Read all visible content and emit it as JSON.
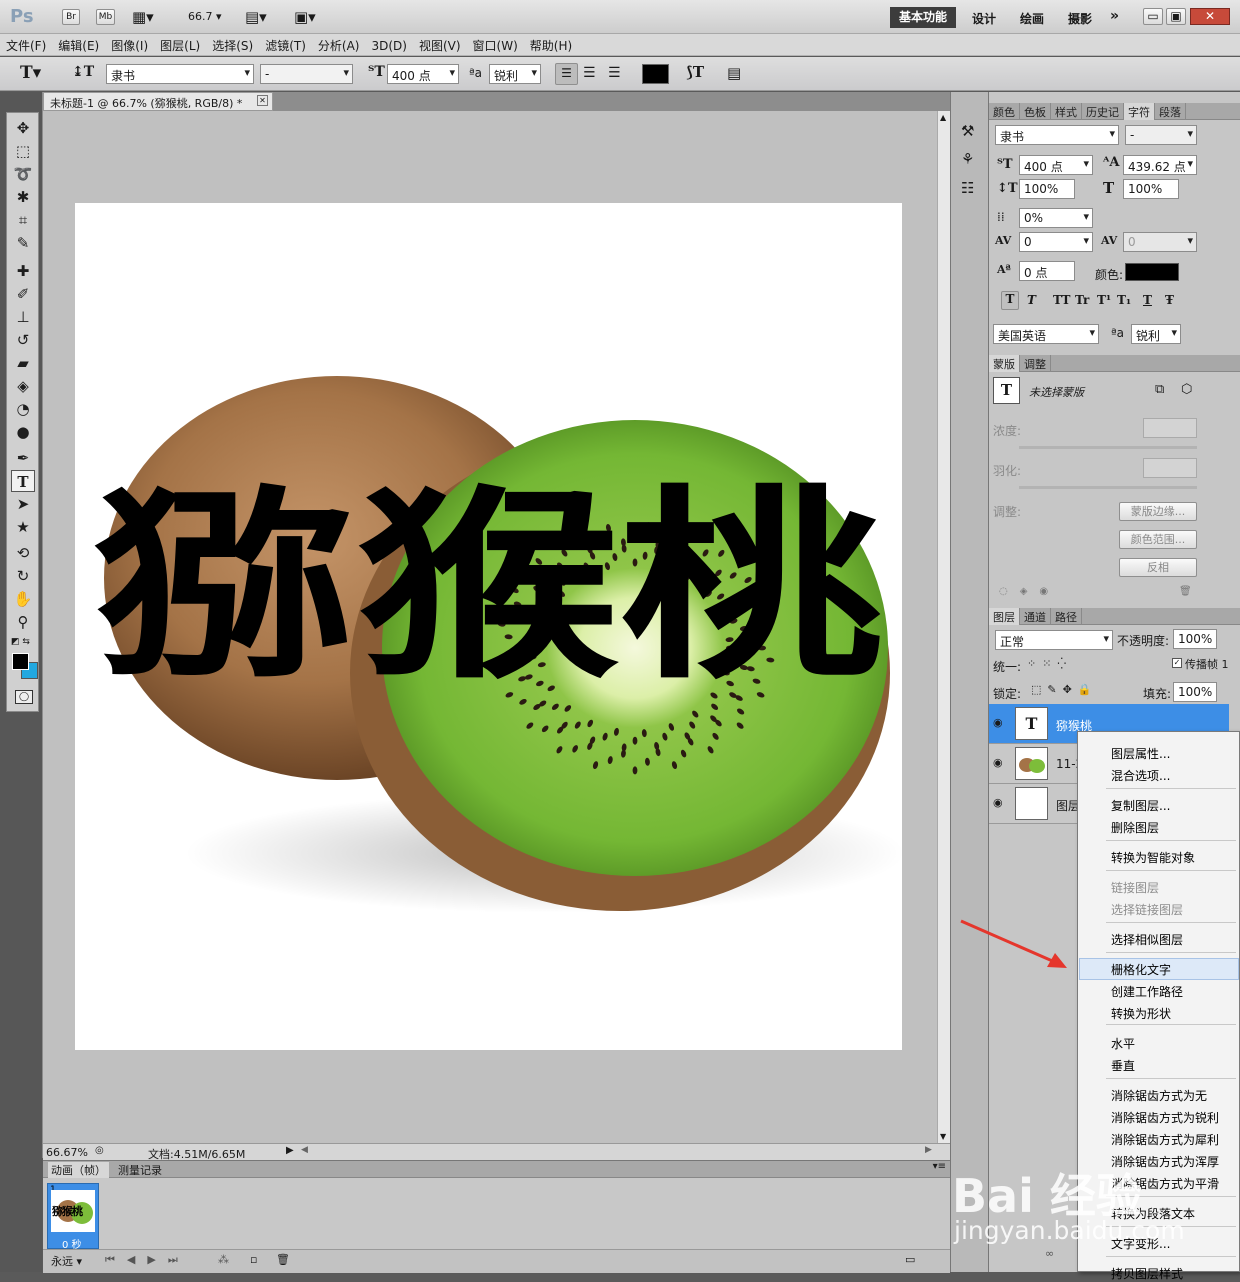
{
  "appbar": {
    "logo": "Ps",
    "bridge": "Br",
    "minibridge": "Mb",
    "zoom": "66.7",
    "workspaces": [
      "基本功能",
      "设计",
      "绘画",
      "摄影"
    ],
    "more": "»"
  },
  "menu": [
    "文件(F)",
    "编辑(E)",
    "图像(I)",
    "图层(L)",
    "选择(S)",
    "滤镜(T)",
    "分析(A)",
    "3D(D)",
    "视图(V)",
    "窗口(W)",
    "帮助(H)"
  ],
  "options": {
    "font_family": "隶书",
    "font_style": "-",
    "font_size": "400 点",
    "aa_icon": "ªa",
    "antialias": "锐利",
    "text_color": "#000000"
  },
  "document": {
    "tab_title": "未标题-1 @ 66.7% (猕猴桃, RGB/8) *",
    "canvas_text": "猕猴桃",
    "zoom_status": "66.67%",
    "doc_status": "文档:4.51M/6.65M"
  },
  "animation": {
    "tab_anim": "动画（帧）",
    "tab_log": "测量记录",
    "frame_number": "1",
    "frame_thumb_text": "猕猴桃",
    "frame_delay": "0 秒",
    "loop": "永远"
  },
  "char_panel": {
    "tabs": [
      "颜色",
      "色板",
      "样式",
      "历史记",
      "字符",
      "段落"
    ],
    "font_family": "隶书",
    "font_style": "-",
    "font_size": "400 点",
    "leading": "439.62 点",
    "vscale": "100%",
    "hscale": "100%",
    "tracking_pct": "0%",
    "kerning": "0",
    "tracking": "0",
    "baseline": "0 点",
    "color_label": "颜色:",
    "language": "美国英语",
    "aa_icon": "ªa",
    "antialias": "锐利",
    "style_buttons": [
      "T",
      "T",
      "TT",
      "Tr",
      "T¹",
      "T₁",
      "T",
      "Ŧ"
    ]
  },
  "mask_panel": {
    "tabs": [
      "蒙版",
      "调整"
    ],
    "no_mask": "未选择蒙版",
    "density": "浓度:",
    "feather": "羽化:",
    "adjust": "调整:",
    "btn_edge": "蒙版边缘...",
    "btn_color": "颜色范围...",
    "btn_invert": "反相"
  },
  "layers_panel": {
    "tabs": [
      "图层",
      "通道",
      "路径"
    ],
    "blend_mode": "正常",
    "opacity_label": "不透明度:",
    "opacity": "100%",
    "unify_label": "统一:",
    "propagate": "传播帧 1",
    "lock_label": "锁定:",
    "fill_label": "填充:",
    "fill": "100%",
    "layers": [
      {
        "name": "猕猴桃",
        "type": "text",
        "selected": true
      },
      {
        "name": "11-2",
        "type": "image",
        "selected": false
      },
      {
        "name": "图层",
        "type": "white",
        "selected": false
      }
    ]
  },
  "context_menu": {
    "groups": [
      [
        {
          "label": "图层属性...",
          "enabled": true
        },
        {
          "label": "混合选项...",
          "enabled": true
        }
      ],
      [
        {
          "label": "复制图层...",
          "enabled": true
        },
        {
          "label": "删除图层",
          "enabled": true
        }
      ],
      [
        {
          "label": "转换为智能对象",
          "enabled": true
        }
      ],
      [
        {
          "label": "链接图层",
          "enabled": false
        },
        {
          "label": "选择链接图层",
          "enabled": false
        }
      ],
      [
        {
          "label": "选择相似图层",
          "enabled": true
        }
      ],
      [
        {
          "label": "栅格化文字",
          "enabled": true,
          "highlight": true
        },
        {
          "label": "创建工作路径",
          "enabled": true
        },
        {
          "label": "转换为形状",
          "enabled": true
        }
      ],
      [
        {
          "label": "水平",
          "enabled": true
        },
        {
          "label": "垂直",
          "enabled": true
        }
      ],
      [
        {
          "label": "消除锯齿方式为无",
          "enabled": true
        },
        {
          "label": "消除锯齿方式为锐利",
          "enabled": true
        },
        {
          "label": "消除锯齿方式为犀利",
          "enabled": true
        },
        {
          "label": "消除锯齿方式为浑厚",
          "enabled": true
        },
        {
          "label": "消除锯齿方式为平滑",
          "enabled": true
        }
      ],
      [
        {
          "label": "转换为段落文本",
          "enabled": true
        }
      ],
      [
        {
          "label": "文字变形...",
          "enabled": true
        }
      ],
      [
        {
          "label": "拷贝图层样式",
          "enabled": true
        }
      ]
    ]
  },
  "watermark": {
    "brand": "Bai 经验",
    "site": "jingyan.baidu.com"
  },
  "colors": {
    "accent_blue": "#3d8ee6",
    "arrow_red": "#e5362c",
    "kiwi_flesh": "#7dbd3a",
    "kiwi_skin": "#a87a4c"
  }
}
